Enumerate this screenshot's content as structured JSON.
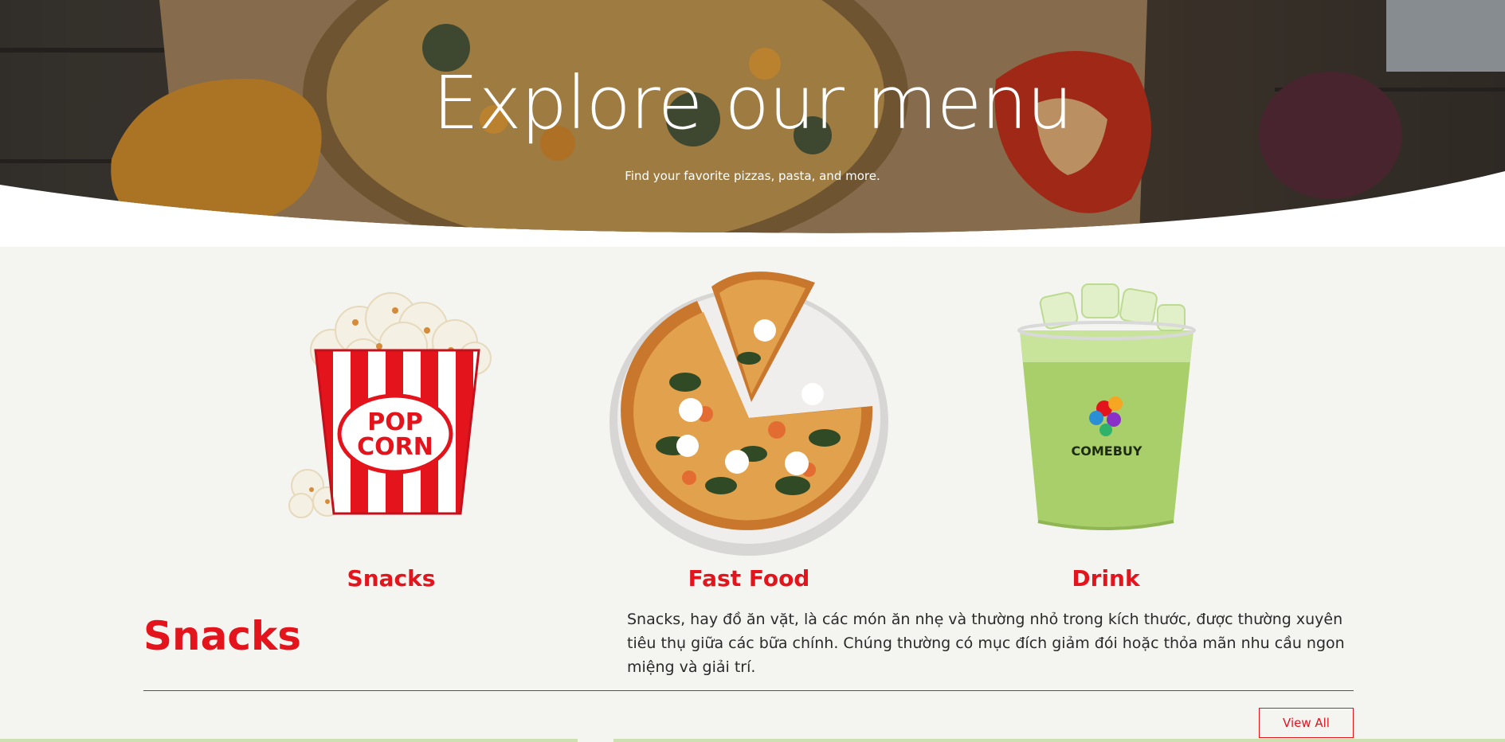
{
  "hero": {
    "title": "Explore our menu",
    "subtitle": "Find your favorite pizzas, pasta, and more."
  },
  "categories": [
    {
      "label": "Snacks",
      "icon": "popcorn-icon"
    },
    {
      "label": "Fast Food",
      "icon": "pizza-icon"
    },
    {
      "label": "Drink",
      "icon": "drink-cup-icon"
    }
  ],
  "section": {
    "heading": "Snacks",
    "description": "Snacks, hay đồ ăn vặt, là các món ăn nhẹ và thường nhỏ trong kích thước, được thường xuyên tiêu thụ giữa các bữa chính. Chúng thường có mục đích giảm đói hoặc thỏa mãn nhu cầu ngon miệng và giải trí.",
    "view_all_label": "View All"
  },
  "drink_brand": "COMEBUY",
  "popcorn_text": [
    "POP",
    "CORN"
  ],
  "colors": {
    "accent": "#e3141c",
    "background": "#f4f4f1",
    "drink": "#a9cf6a"
  }
}
